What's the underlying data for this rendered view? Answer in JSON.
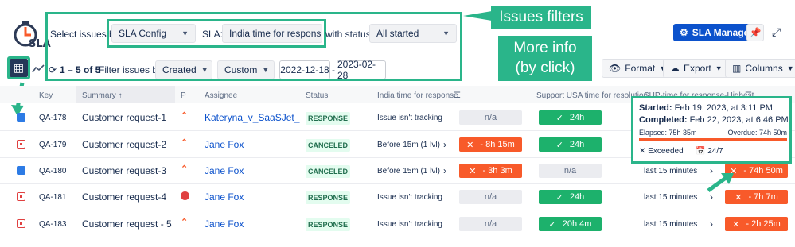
{
  "logo": {
    "text": "SLA"
  },
  "filters": {
    "select_issues_label": "Select issues by:",
    "sla_config": "SLA Config",
    "sla_label": "SLA:",
    "sla_value": "India time for respons...",
    "with_status_label": "with status:",
    "status_value": "All started",
    "range": "1 – 5 of 5",
    "filter_by_label": "Filter issues by:",
    "filter_by_value": "Created",
    "period_value": "Custom",
    "date_from": "2022-12-18",
    "date_sep": "-",
    "date_to": "2023-02-28"
  },
  "callouts": {
    "filters": "Issues filters",
    "more_info": "More info\n(by click)"
  },
  "toolbar": {
    "sla_manager": "SLA Manager",
    "format": "Format",
    "export": "Export",
    "columns": "Columns"
  },
  "table": {
    "headers": [
      "Key",
      "Summary",
      "P",
      "Assignee",
      "Status",
      "India time for response",
      "Support USA time for resolution",
      "SUP-time for response-Highest"
    ],
    "rows": [
      {
        "key": "QA-178",
        "summary": "Customer request-1",
        "assignee": "Kateryna_v_SaaSJet_",
        "status": "RESPONSE",
        "col1_text": "Issue isn't tracking",
        "col1_chip": "n/a",
        "col2_chip": "24h",
        "col3_text": "",
        "col3_chip": ""
      },
      {
        "key": "QA-179",
        "summary": "Customer request-2",
        "assignee": "Jane Fox",
        "status": "CANCELED",
        "col1_text": "Before 15m (1 lvl)",
        "col1_chip": "- 8h 15m",
        "col2_chip": "24h",
        "col3_text": "",
        "col3_chip": ""
      },
      {
        "key": "QA-180",
        "summary": "Customer request-3",
        "assignee": "Jane Fox",
        "status": "CANCELED",
        "col1_text": "Before 15m (1 lvl)",
        "col1_chip": "- 3h 3m",
        "col2_chip": "n/a",
        "col3_text": "last 15 minutes",
        "col3_chip": "- 74h 50m"
      },
      {
        "key": "QA-181",
        "summary": "Customer request-4",
        "assignee": "Jane Fox",
        "status": "RESPONSE",
        "col1_text": "Issue isn't tracking",
        "col1_chip": "n/a",
        "col2_chip": "24h",
        "col3_text": "last 15 minutes",
        "col3_chip": "- 7h 7m"
      },
      {
        "key": "QA-183",
        "summary": "Customer request - 5",
        "assignee": "Jane Fox",
        "status": "RESPONSE",
        "col1_text": "Issue isn't tracking",
        "col1_chip": "n/a",
        "col2_chip": "20h 4m",
        "col3_text": "last 15 minutes",
        "col3_chip": "- 2h 25m"
      }
    ]
  },
  "popup": {
    "started_label": "Started:",
    "started_value": "Feb 19, 2023, at 3:11 PM",
    "completed_label": "Completed:",
    "completed_value": "Feb 22, 2023, at 6:46 PM",
    "elapsed": "Elapsed: 75h 35m",
    "overdue": "Overdue: 74h 50m",
    "exceeded": "Exceeded",
    "calendar": "24/7"
  },
  "colors": {
    "accent": "#2ab58a",
    "brand": "#0c52cc",
    "bad": "#f85a2a",
    "ok": "#1db16c"
  }
}
